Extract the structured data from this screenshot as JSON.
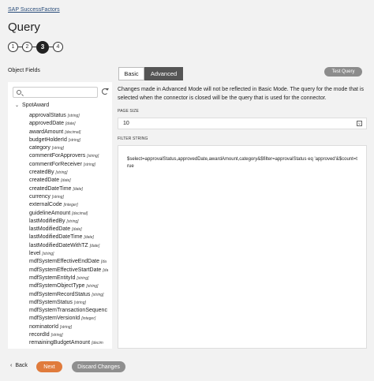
{
  "breadcrumb": "SAP SuccessFactors",
  "page_title": "Query",
  "steps": [
    "1",
    "2",
    "3",
    "4"
  ],
  "active_step": "3",
  "object_fields_label": "Object Fields",
  "search_placeholder": "",
  "tree": {
    "root": "SpotAward",
    "fields": [
      {
        "name": "approvalStatus",
        "type": "[string]"
      },
      {
        "name": "approvedDate",
        "type": "[date]"
      },
      {
        "name": "awardAmount",
        "type": "[decimal]"
      },
      {
        "name": "budgetHolderId",
        "type": "[string]"
      },
      {
        "name": "category",
        "type": "[string]"
      },
      {
        "name": "commentForApprovers",
        "type": "[string]"
      },
      {
        "name": "commentForReceiver",
        "type": "[string]"
      },
      {
        "name": "createdBy",
        "type": "[string]"
      },
      {
        "name": "createdDate",
        "type": "[date]"
      },
      {
        "name": "createdDateTime",
        "type": "[date]"
      },
      {
        "name": "currency",
        "type": "[string]"
      },
      {
        "name": "externalCode",
        "type": "[integer]"
      },
      {
        "name": "guidelineAmount",
        "type": "[decimal]"
      },
      {
        "name": "lastModifiedBy",
        "type": "[string]"
      },
      {
        "name": "lastModifiedDate",
        "type": "[date]"
      },
      {
        "name": "lastModifiedDateTime",
        "type": "[date]"
      },
      {
        "name": "lastModifiedDateWithTZ",
        "type": "[date]"
      },
      {
        "name": "level",
        "type": "[string]"
      },
      {
        "name": "mdfSystemEffectiveEndDate",
        "type": "[da"
      },
      {
        "name": "mdfSystemEffectiveStartDate",
        "type": "[da"
      },
      {
        "name": "mdfSystemEntityId",
        "type": "[string]"
      },
      {
        "name": "mdfSystemObjectType",
        "type": "[string]"
      },
      {
        "name": "mdfSystemRecordStatus",
        "type": "[string]"
      },
      {
        "name": "mdfSystemStatus",
        "type": "[string]"
      },
      {
        "name": "mdfSystemTransactionSequenc",
        "type": ""
      },
      {
        "name": "mdfSystemVersionId",
        "type": "[integer]"
      },
      {
        "name": "nominatorId",
        "type": "[string]"
      },
      {
        "name": "recordId",
        "type": "[string]"
      },
      {
        "name": "remainingBudgetAmount",
        "type": "[decim"
      }
    ]
  },
  "tabs": {
    "basic": "Basic",
    "advanced": "Advanced"
  },
  "test_query_label": "Test Query",
  "notice": "Changes made in Advanced Mode will not be reflected in Basic Mode. The query for the mode that is selected when the connector is closed will be the query that is used for the connector.",
  "page_size": {
    "label": "PAGE SIZE",
    "value": "10"
  },
  "filter_string": {
    "label": "FILTER STRING",
    "value": "$select=approvalStatus,approvedDate,awardAmount,category&$filter=approvalStatus eq 'approved'&$count=true"
  },
  "footer": {
    "back": "Back",
    "next": "Next",
    "discard": "Discard Changes"
  },
  "colors": {
    "next": "#e07b3c",
    "discard": "#8f8f8f",
    "active_tab": "#555555"
  }
}
